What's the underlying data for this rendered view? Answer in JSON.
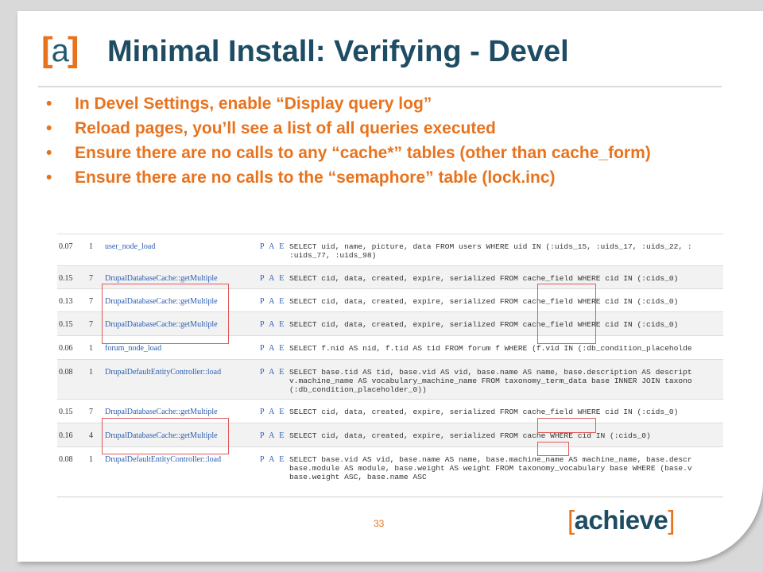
{
  "logo": {
    "left_bracket": "[",
    "letter": "a",
    "right_bracket": "]"
  },
  "title": "Minimal Install: Verifying - Devel",
  "bullets": [
    "In Devel Settings, enable “Display query log”",
    "Reload pages, you’ll see a list of all queries executed",
    "Ensure there are no calls to any “cache*” tables (other than cache_form)",
    "Ensure there are no calls to the “semaphore” table (lock.inc)"
  ],
  "query_log": {
    "rows": [
      {
        "time": "0.07",
        "count": "1",
        "function": "user_node_load",
        "pae": "P A E",
        "sql": "SELECT uid, name, picture, data FROM users WHERE uid IN (:uids_15, :uids_17, :uids_22, :\n:uids_77, :uids_98)"
      },
      {
        "time": "0.15",
        "count": "7",
        "function": "DrupalDatabaseCache::getMultiple",
        "pae": "P A E",
        "sql": "SELECT cid, data, created, expire, serialized FROM cache_field WHERE cid IN (:cids_0)"
      },
      {
        "time": "0.13",
        "count": "7",
        "function": "DrupalDatabaseCache::getMultiple",
        "pae": "P A E",
        "sql": "SELECT cid, data, created, expire, serialized FROM cache_field WHERE cid IN (:cids_0)"
      },
      {
        "time": "0.15",
        "count": "7",
        "function": "DrupalDatabaseCache::getMultiple",
        "pae": "P A E",
        "sql": "SELECT cid, data, created, expire, serialized FROM cache_field WHERE cid IN (:cids_0)"
      },
      {
        "time": "0.06",
        "count": "1",
        "function": "forum_node_load",
        "pae": "P A E",
        "sql": "SELECT f.nid AS nid, f.tid AS tid FROM forum f WHERE (f.vid IN (:db_condition_placeholde"
      },
      {
        "time": "0.08",
        "count": "1",
        "function": "DrupalDefaultEntityController::load",
        "pae": "P A E",
        "sql": "SELECT base.tid AS tid, base.vid AS vid, base.name AS name, base.description AS descript\nv.machine_name AS vocabulary_machine_name FROM taxonomy_term_data base INNER JOIN taxono\n(:db_condition_placeholder_0))"
      },
      {
        "time": "0.15",
        "count": "7",
        "function": "DrupalDatabaseCache::getMultiple",
        "pae": "P A E",
        "sql": "SELECT cid, data, created, expire, serialized FROM cache_field WHERE cid IN (:cids_0)"
      },
      {
        "time": "0.16",
        "count": "4",
        "function": "DrupalDatabaseCache::getMultiple",
        "pae": "P A E",
        "sql": "SELECT cid, data, created, expire, serialized FROM cache WHERE cid IN (:cids_0)"
      },
      {
        "time": "0.08",
        "count": "1",
        "function": "DrupalDefaultEntityController::load",
        "pae": "P A E",
        "sql": "SELECT base.vid AS vid, base.name AS name, base.machine_name AS machine_name, base.descr\nbase.module AS module, base.weight AS weight FROM taxonomy_vocabulary base WHERE (base.v\nbase.weight ASC, base.name ASC"
      }
    ]
  },
  "page_number": "33",
  "brand": {
    "left_bracket": "[",
    "word": "achieve",
    "right_bracket": "]"
  },
  "colors": {
    "accent_orange": "#e8731e",
    "title_navy": "#1e4c63",
    "highlight_red": "#e05a5a",
    "link_blue": "#2a5db0"
  }
}
